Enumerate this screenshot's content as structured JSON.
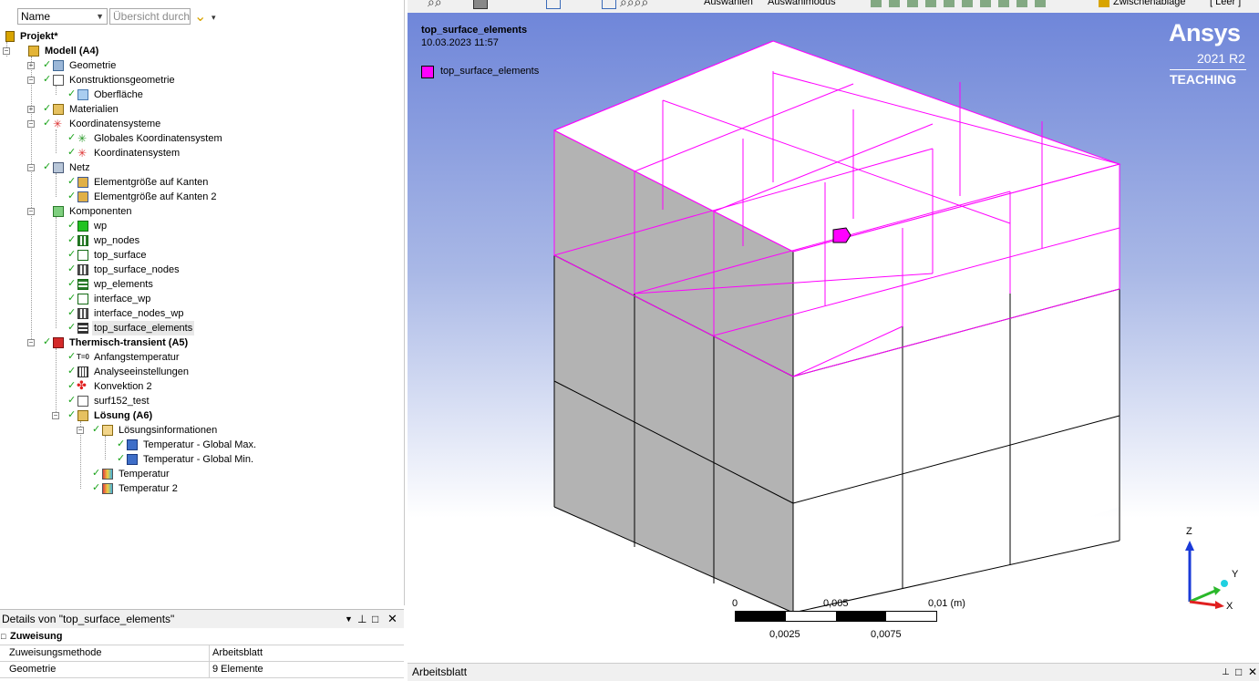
{
  "tree_toolbar": {
    "name_combo": "Name",
    "search_placeholder": "Übersicht durch"
  },
  "tree": {
    "project": "Projekt*",
    "model": "Modell (A4)",
    "geometry": "Geometrie",
    "construction_geometry": "Konstruktionsgeometrie",
    "surface": "Oberfläche",
    "materials": "Materialien",
    "coordinate_systems": "Koordinatensysteme",
    "global_cs": "Globales Koordinatensystem",
    "cs": "Koordinatensystem",
    "mesh": "Netz",
    "edge_sizing": "Elementgröße auf Kanten",
    "edge_sizing_2": "Elementgröße auf Kanten 2",
    "components": "Komponenten",
    "c_wp": "wp",
    "c_wp_nodes": "wp_nodes",
    "c_top_surface": "top_surface",
    "c_top_surface_nodes": "top_surface_nodes",
    "c_wp_elements": "wp_elements",
    "c_interface_wp": "interface_wp",
    "c_interface_nodes_wp": "interface_nodes_wp",
    "c_top_surface_elements": "top_surface_elements",
    "transient": "Thermisch-transient (A5)",
    "initial_temp": "Anfangstemperatur",
    "analysis_settings": "Analyseeinstellungen",
    "convection": "Konvektion 2",
    "surf152": "surf152_test",
    "solution": "Lösung (A6)",
    "solution_info": "Lösungsinformationen",
    "temp_max": "Temperatur - Global Max.",
    "temp_min": "Temperatur - Global Min.",
    "temperature": "Temperatur",
    "temperature_2": "Temperatur 2"
  },
  "details": {
    "title": "Details von \"top_surface_elements\"",
    "section": "Zuweisung",
    "rows": [
      {
        "key": "Zuweisungsmethode",
        "value": "Arbeitsblatt"
      },
      {
        "key": "Geometrie",
        "value": "9 Elemente"
      }
    ]
  },
  "top_toolbar": {
    "select_label": "Auswählen",
    "select_mode_label": "Auswahlmodus",
    "clipboard_label": "Zwischenablage",
    "empty_label": "[ Leer ]"
  },
  "viewport": {
    "title": "top_surface_elements",
    "timestamp": "10.03.2023 11:57",
    "legend_label": "top_surface_elements",
    "legend_color": "#ff00ff",
    "brand": "Ansys",
    "version": "2021 R2",
    "edition": "TEACHING",
    "scale": {
      "ticks_top": [
        "0",
        "0,005",
        "0,01 (m)"
      ],
      "ticks_bottom": [
        "0,0025",
        "0,0075"
      ]
    },
    "triad": {
      "z": "Z",
      "y": "Y",
      "x": "X"
    }
  },
  "bottom_bar": {
    "label": "Arbeitsblatt"
  }
}
